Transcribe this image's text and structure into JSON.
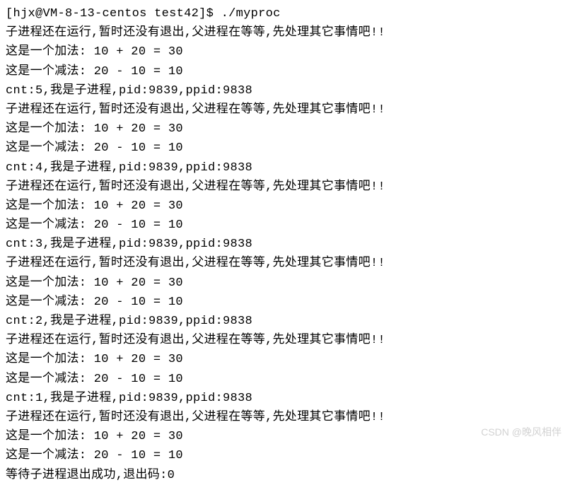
{
  "prompt": {
    "user": "hjx",
    "host": "VM-8-13-centos",
    "dir": "test42",
    "symbol": "$",
    "command": "./myproc"
  },
  "loop": {
    "running_msg": "子进程还在运行,暂时还没有退出,父进程在等等,先处理其它事情吧!!",
    "add_msg": "这是一个加法: 10 + 20 = 30",
    "sub_msg": "这是一个减法: 20 - 10 = 10",
    "child_prefix": "cnt:",
    "child_mid": ",我是子进程,pid:",
    "child_ppid": ",ppid:",
    "pid": "9839",
    "ppid": "9838",
    "counts": [
      "5",
      "4",
      "3",
      "2",
      "1"
    ]
  },
  "final": "等待子进程退出成功,退出码:0",
  "watermark": "CSDN @晚风相伴"
}
